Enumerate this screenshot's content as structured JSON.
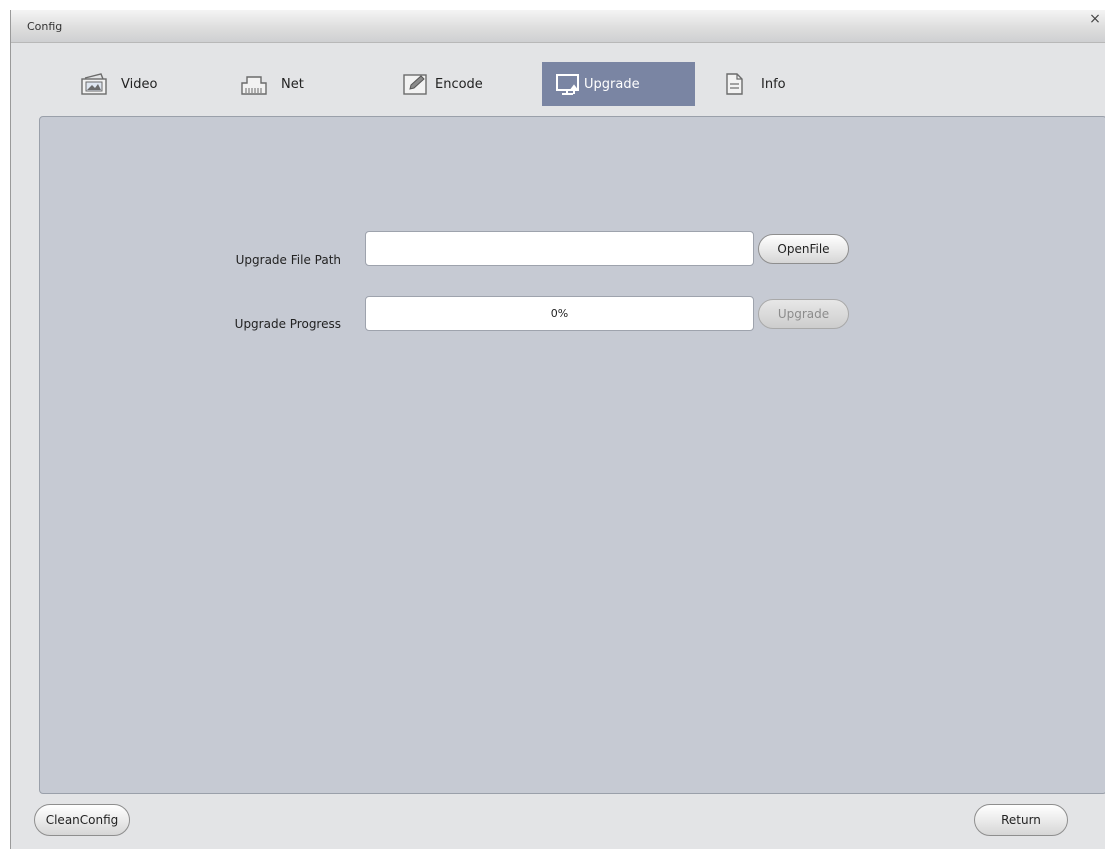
{
  "window": {
    "title": "Config"
  },
  "tabs": [
    {
      "label": "Video",
      "icon": "video-picture-icon",
      "active": false
    },
    {
      "label": "Net",
      "icon": "network-port-icon",
      "active": false
    },
    {
      "label": "Encode",
      "icon": "edit-pencil-icon",
      "active": false
    },
    {
      "label": "Upgrade",
      "icon": "monitor-upload-icon",
      "active": true
    },
    {
      "label": "Info",
      "icon": "document-icon",
      "active": false
    }
  ],
  "upgrade": {
    "file_path_label": "Upgrade File Path",
    "file_path_value": "",
    "open_file_label": "OpenFile",
    "progress_label": "Upgrade Progress",
    "progress_text": "0%",
    "progress_value": 0,
    "upgrade_button_label": "Upgrade",
    "upgrade_button_enabled": false
  },
  "footer": {
    "clean_config_label": "CleanConfig",
    "return_label": "Return"
  },
  "colors": {
    "active_tab": "#7a85a3",
    "panel_bg": "#c6cad3",
    "window_bg": "#e3e4e6"
  }
}
